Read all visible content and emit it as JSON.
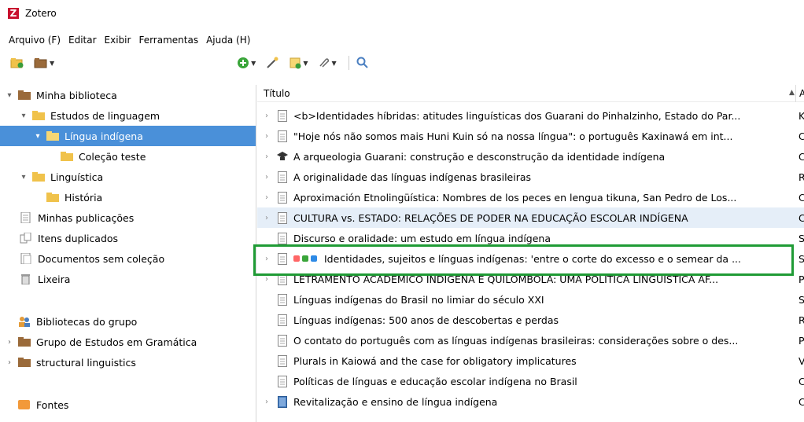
{
  "app": {
    "title": "Zotero",
    "logo_letter": "Z"
  },
  "menu": [
    "Arquivo (F)",
    "Editar",
    "Exibir",
    "Ferramentas",
    "Ajuda (H)"
  ],
  "tree": {
    "my_library": "Minha biblioteca",
    "studies": "Estudos de linguagem",
    "indigenous": "Língua indígena",
    "test_collection": "Coleção teste",
    "linguistics": "Linguística",
    "history": "História",
    "my_publications": "Minhas publicações",
    "duplicates": "Itens duplicados",
    "unfiled": "Documentos sem coleção",
    "trash": "Lixeira",
    "group_libraries": "Bibliotecas do grupo",
    "group_grammar": "Grupo de Estudos em Gramática",
    "structural": "structural linguistics",
    "feeds": "Fontes"
  },
  "items": {
    "column_title": "Título",
    "column2_initial": "A",
    "rows": [
      {
        "text": "<b>Identidades híbridas: atitudes linguísticas dos Guarani do Pinhalzinho, Estado do Par...",
        "col2": "K"
      },
      {
        "text": "\"Hoje nós não somos mais Huni Kuin só na nossa língua\": o português Kaxinawá em int...",
        "col2": "C"
      },
      {
        "text": "A arqueologia Guarani: construção e desconstrução da identidade indígena",
        "col2": "C"
      },
      {
        "text": "A originalidade das línguas indígenas brasileiras",
        "col2": "R"
      },
      {
        "text": "Aproximación Etnolingüística: Nombres de los peces en lengua tikuna, San Pedro de Los...",
        "col2": "C"
      },
      {
        "text": "CULTURA vs. ESTADO: RELAÇÕES DE PODER NA EDUCAÇÃO ESCOLAR INDÍGENA",
        "col2": "C"
      },
      {
        "text": "Discurso e oralidade: um estudo em língua indígena",
        "col2": "S"
      },
      {
        "text": "Identidades, sujeitos e línguas indígenas: 'entre o corte do excesso e o semear da ...",
        "col2": "S"
      },
      {
        "text": "LETRAMENTO ACADÊMICO INDÍGENA E QUILOMBOLA: UMA POLÍTICA LINGUÍSTICA AF...",
        "col2": "P"
      },
      {
        "text": "Línguas indígenas do Brasil no limiar do século XXI",
        "col2": "S"
      },
      {
        "text": "Línguas indígenas: 500 anos de descobertas e perdas",
        "col2": "R"
      },
      {
        "text": "O contato do português com as línguas indígenas brasileiras: considerações sobre o des...",
        "col2": "P"
      },
      {
        "text": "Plurals in Kaiowá and the case for obligatory implicatures",
        "col2": "V"
      },
      {
        "text": "Políticas de línguas e educação escolar indígena no Brasil",
        "col2": "C"
      },
      {
        "text": "Revitalização e ensino de língua indígena",
        "col2": "C"
      }
    ]
  },
  "colors": {
    "selection": "#4a90d9",
    "highlight_box": "#1f9b35",
    "folder": "#f0c24b"
  }
}
